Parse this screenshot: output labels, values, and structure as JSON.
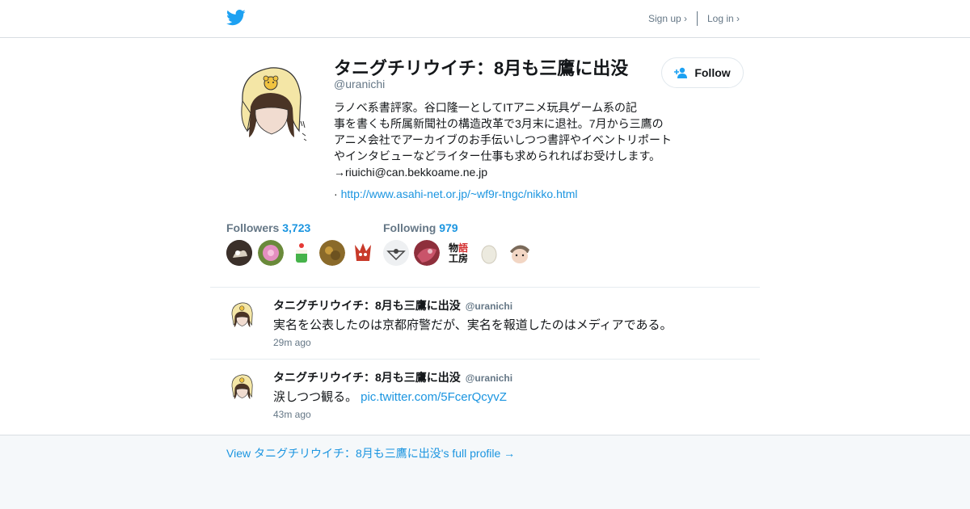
{
  "header": {
    "signup_label": "Sign up ›",
    "login_label": "Log in ›"
  },
  "profile": {
    "name": "タニグチリウイチ：8月も三鷹に出没",
    "handle": "@uranichi",
    "follow_label": "Follow",
    "bio": "ラノベ系書評家。谷口隆一としてITアニメ玩具ゲーム系の記\n事を書くも所属新聞社の構造改革で3月末に退社。7月から三鷹の\nアニメ会社でアーカイブのお手伝いしつつ書評やイベントリポート\nやインタビューなどライター仕事も求められればお受けします。\n→riuichi@can.bekkoame.ne.jp",
    "url_prefix": "·",
    "url": "http://www.asahi-net.or.jp/~wf9r-tngc/nikko.html"
  },
  "stats": {
    "followers_label": "Followers",
    "followers_count": "3,723",
    "following_label": "Following",
    "following_count": "979"
  },
  "mini_avatars": {
    "followers": [
      "dark-photo",
      "pink-flower",
      "cake-illustration",
      "food-photo",
      "red-character"
    ],
    "following": [
      "white-icon",
      "red-creature",
      "monogatari-koubou-logo",
      "white-egg",
      "face-illustration"
    ],
    "following_logo_text": "物語\n工房"
  },
  "tweets": [
    {
      "name": "タニグチリウイチ：8月も三鷹に出没",
      "handle": "@uranichi",
      "text": "実名を公表したのは京都府警だが、実名を報道したのはメディアである。",
      "link": "",
      "time": "29m ago"
    },
    {
      "name": "タニグチリウイチ：8月も三鷹に出没",
      "handle": "@uranichi",
      "text": "涙しつつ観る。",
      "link": "pic.twitter.com/5FcerQcyvZ",
      "time": "43m ago"
    }
  ],
  "footer": {
    "view_profile_label": "View タニグチリウイチ：8月も三鷹に出没's full profile →"
  },
  "colors": {
    "twitter_blue": "#1da1f2",
    "link_blue": "#1b95e0",
    "muted_gray": "#657786",
    "footer_bg": "#f5f8fa"
  }
}
